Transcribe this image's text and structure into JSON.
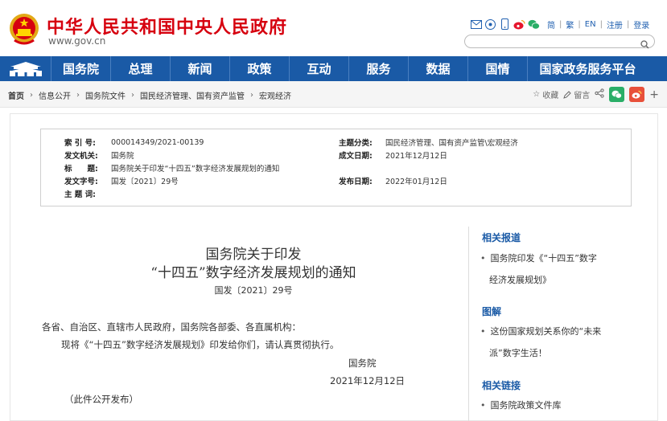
{
  "header": {
    "site_title": "中华人民共和国中央人民政府",
    "site_url": "www.gov.cn",
    "links": [
      "简",
      "繁",
      "EN",
      "注册",
      "登录"
    ],
    "search_placeholder": ""
  },
  "nav": {
    "items": [
      "国务院",
      "总理",
      "新闻",
      "政策",
      "互动",
      "服务",
      "数据",
      "国情",
      "国家政务服务平台"
    ]
  },
  "breadcrumb": {
    "items": [
      "首页",
      "信息公开",
      "国务院文件",
      "国民经济管理、国有资产监管",
      "宏观经济"
    ]
  },
  "page_tools": {
    "favorite": "收藏",
    "message": "留言"
  },
  "meta": {
    "index_no_label": "索 引 号:",
    "index_no": "000014349/2021-00139",
    "topic_label": "主题分类:",
    "topic": "国民经济管理、国有资产监管\\宏观经济",
    "issuer_label": "发文机关:",
    "issuer": "国务院",
    "created_label": "成文日期:",
    "created": "2021年12月12日",
    "title_label": "标　　题:",
    "title": "国务院关于印发“十四五”数字经济发展规划的通知",
    "doc_no_label": "发文字号:",
    "doc_no": "国发〔2021〕29号",
    "published_label": "发布日期:",
    "published": "2022年01月12日",
    "keywords_label": "主 题 词:"
  },
  "article": {
    "title_line1": "国务院关于印发",
    "title_line2": "“十四五”数字经济发展规划的通知",
    "doc_no": "国发〔2021〕29号",
    "salutation": "各省、自治区、直辖市人民政府，国务院各部委、各直属机构：",
    "body": "现将《“十四五”数字经济发展规划》印发给你们，请认真贯彻执行。",
    "signer": "国务院",
    "date": "2021年12月12日",
    "note": "（此件公开发布）"
  },
  "sidebar": {
    "related_reports_title": "相关报道",
    "related_report_line1": "国务院印发《“十四五”数字",
    "related_report_line2": "经济发展规划》",
    "illustration_title": "图解",
    "illustration_line1": "这份国家规划关系你的“未来",
    "illustration_line2": "派”数字生活！",
    "related_links_title": "相关链接",
    "related_link_1": "国务院政策文件库"
  },
  "colors": {
    "brand_red": "#d6000f",
    "nav_blue": "#1a5aa6",
    "link_blue": "#2060b0"
  }
}
